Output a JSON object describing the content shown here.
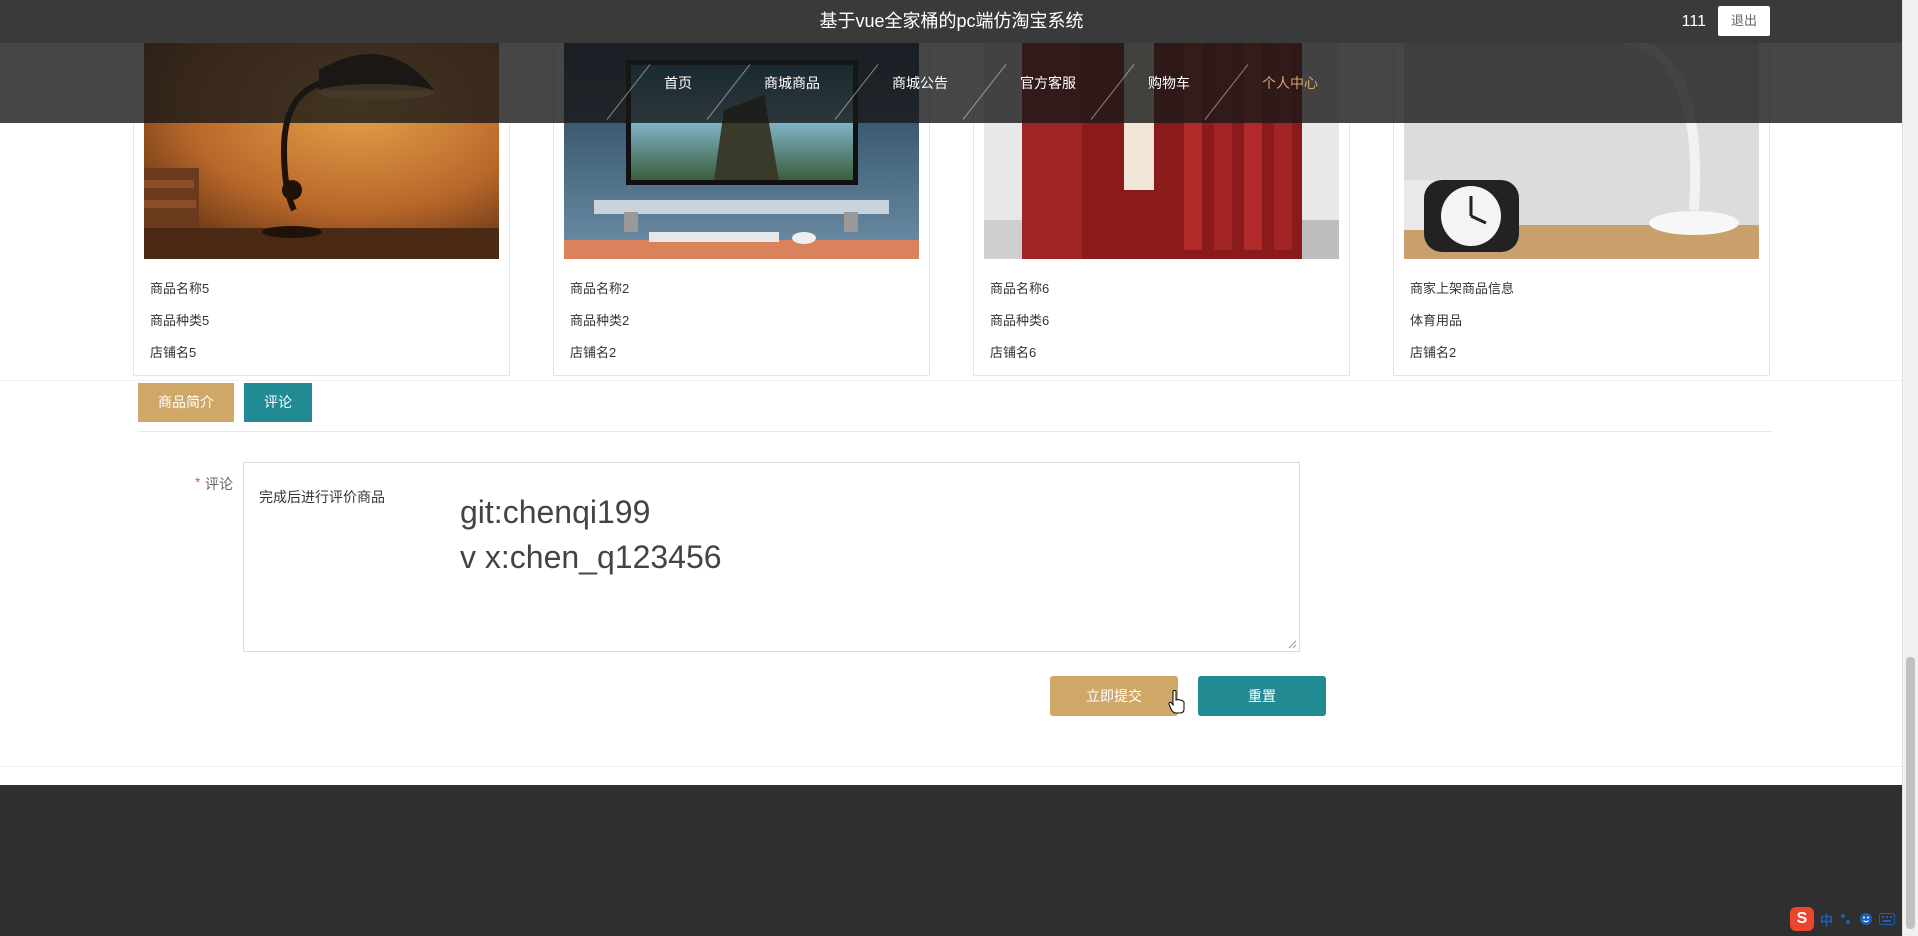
{
  "header": {
    "title": "基于vue全家桶的pc端仿淘宝系统",
    "username": "111",
    "logout_label": "退出"
  },
  "nav": {
    "items": [
      {
        "label": "首页"
      },
      {
        "label": "商城商品"
      },
      {
        "label": "商城公告"
      },
      {
        "label": "官方客服"
      },
      {
        "label": "购物车"
      },
      {
        "label": "个人中心"
      }
    ],
    "active_index": 5,
    "active_color": "#d1a66a"
  },
  "products": [
    {
      "name": "商品名称5",
      "category": "商品种类5",
      "shop": "店铺名5",
      "image": "desk-lamp-photo"
    },
    {
      "name": "商品名称2",
      "category": "商品种类2",
      "shop": "店铺名2",
      "image": "computer-desk-photo"
    },
    {
      "name": "商品名称6",
      "category": "商品种类6",
      "shop": "店铺名6",
      "image": "red-books-photo"
    },
    {
      "name": "商家上架商品信息",
      "category": "体育用品",
      "shop": "店铺名2",
      "image": "clock-lamp-photo"
    }
  ],
  "tabs": {
    "intro_label": "商品简介",
    "comment_label": "评论"
  },
  "form": {
    "required_mark": "*",
    "comment_label": "评论",
    "comment_value": "完成后进行评价商品"
  },
  "watermark": {
    "line1": "git:chenqi199",
    "line2": "v x:chen_q123456"
  },
  "buttons": {
    "submit_label": "立即提交",
    "reset_label": "重置"
  },
  "colors": {
    "gold": "#cfa868",
    "teal": "#218a93",
    "dark_header": "#3a3a3a",
    "footer": "#2f2f2f"
  },
  "ime": {
    "logo": "S",
    "mode": "中"
  }
}
